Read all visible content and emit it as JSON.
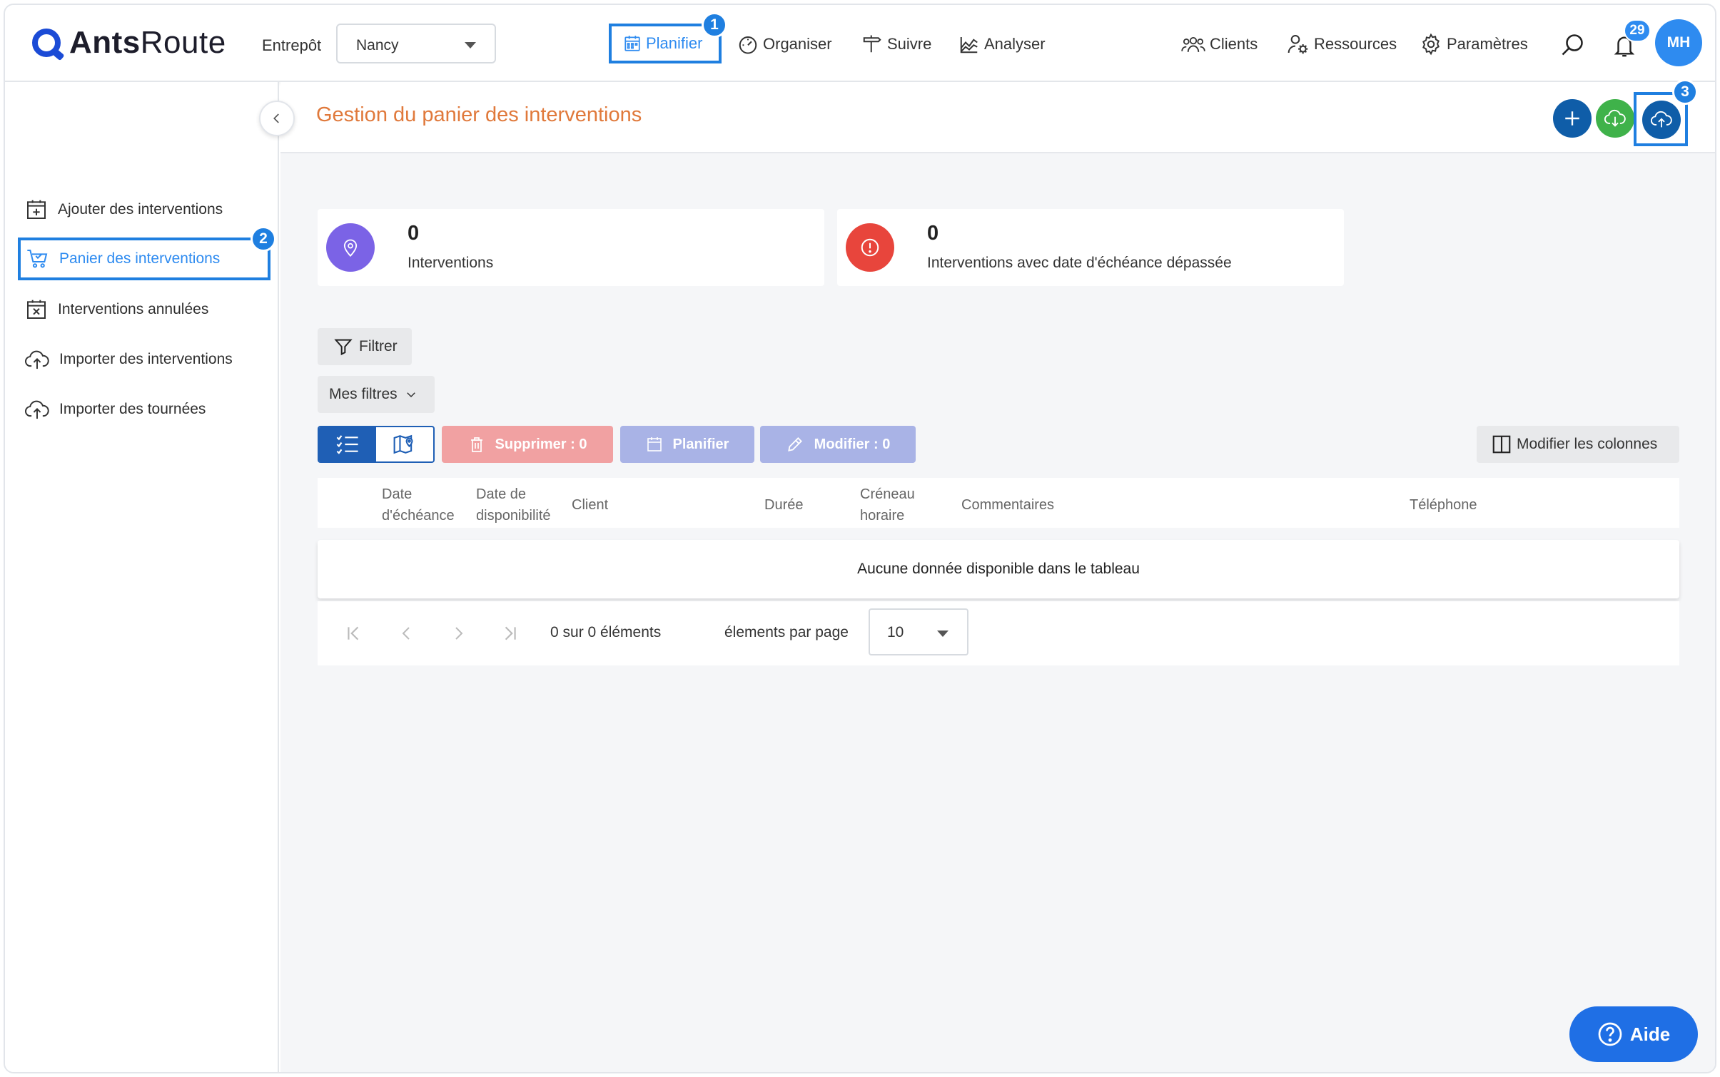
{
  "app": {
    "logo_bold": "Ants",
    "logo_regular": "Route"
  },
  "topbar": {
    "warehouse_label": "Entrepôt",
    "warehouse_value": "Nancy",
    "nav": {
      "planifier": "Planifier",
      "organiser": "Organiser",
      "suivre": "Suivre",
      "analyser": "Analyser",
      "clients": "Clients",
      "ressources": "Ressources",
      "parametres": "Paramètres"
    },
    "notification_count": "29",
    "avatar_initials": "MH"
  },
  "steps": {
    "one": "1",
    "two": "2",
    "three": "3"
  },
  "sidebar": {
    "items": [
      {
        "label": "Ajouter des interventions",
        "icon": "calendar-plus-icon"
      },
      {
        "label": "Panier des interventions",
        "icon": "cart-icon"
      },
      {
        "label": "Interventions annulées",
        "icon": "calendar-x-icon"
      },
      {
        "label": "Importer des interventions",
        "icon": "cloud-upload-icon"
      },
      {
        "label": "Importer des tournées",
        "icon": "cloud-upload-icon"
      }
    ]
  },
  "main": {
    "title": "Gestion du panier des interventions",
    "stats": [
      {
        "value": "0",
        "label": "Interventions"
      },
      {
        "value": "0",
        "label": "Interventions avec date d'échéance dépassée"
      }
    ],
    "filter_label": "Filtrer",
    "my_filters_label": "Mes filtres",
    "delete_label": "Supprimer : 0",
    "plan_label": "Planifier",
    "modify_label": "Modifier : 0",
    "columns_label": "Modifier les colonnes",
    "table": {
      "headers": {
        "due_date_1": "Date",
        "due_date_2": "d'échéance",
        "avail_1": "Date de",
        "avail_2": "disponibilité",
        "client": "Client",
        "duration": "Durée",
        "slot_1": "Créneau",
        "slot_2": "horaire",
        "comments": "Commentaires",
        "phone": "Téléphone"
      },
      "empty_message": "Aucune donnée disponible dans le tableau"
    },
    "pager": {
      "info": "0 sur 0 éléments",
      "per_page_label": "élements par page",
      "per_page_value": "10"
    }
  },
  "help_label": "Aide",
  "colors": {
    "accent": "#1f7fe0",
    "title": "#e0793b",
    "primary_dark": "#0f5da8",
    "green": "#3fb24a",
    "danger": "#e8453c",
    "purple": "#7b63e6"
  }
}
